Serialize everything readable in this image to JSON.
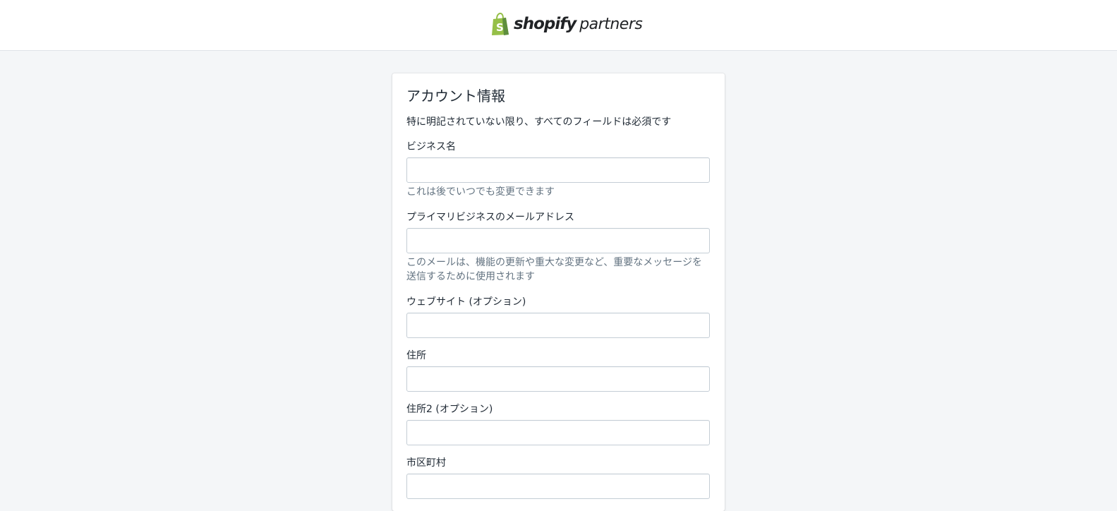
{
  "header": {
    "logo_word_1": "shopify",
    "logo_word_2": "partners",
    "brand_color": "#95bf47"
  },
  "form": {
    "title": "アカウント情報",
    "subtitle": "特に明記されていない限り、すべてのフィールドは必須です",
    "fields": [
      {
        "label": "ビジネス名",
        "value": "",
        "help": "これは後でいつでも変更できます"
      },
      {
        "label": "プライマリビジネスのメールアドレス",
        "value": "",
        "help": "このメールは、機能の更新や重大な変更など、重要なメッセージを送信するために使用されます"
      },
      {
        "label": "ウェブサイト (オプション)",
        "value": ""
      },
      {
        "label": "住所",
        "value": ""
      },
      {
        "label": "住所2 (オプション)",
        "value": ""
      },
      {
        "label": "市区町村",
        "value": ""
      }
    ]
  }
}
